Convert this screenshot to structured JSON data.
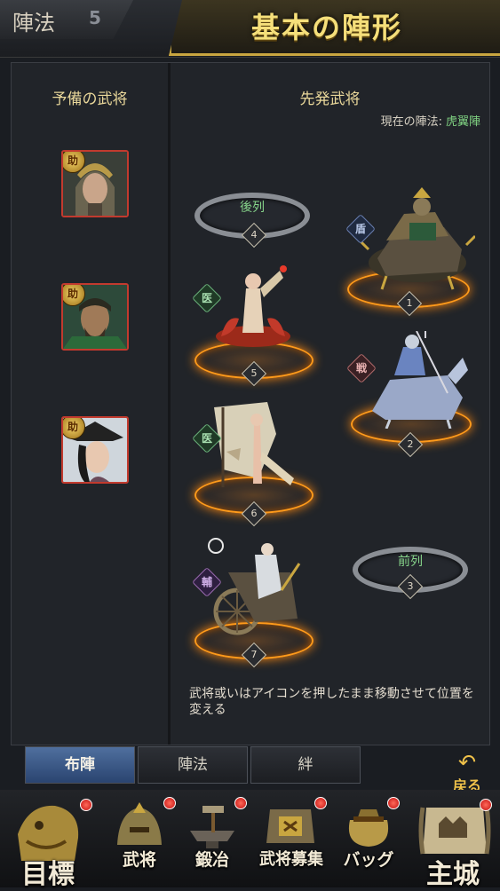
{
  "header": {
    "left_title": "陣法",
    "left_mark": "5",
    "title": "基本の陣形"
  },
  "reserve": {
    "title": "予備の武将",
    "badge": "助",
    "portraits": [
      {
        "name": "reserve-general-1"
      },
      {
        "name": "reserve-general-2"
      },
      {
        "name": "reserve-general-3"
      }
    ]
  },
  "starters": {
    "title": "先発武将",
    "current_label": "現在の陣法:",
    "current_value": "虎翼陣",
    "back_row_label": "後列",
    "front_row_label": "前列",
    "slots": {
      "s1": "1",
      "s2": "2",
      "s3": "3",
      "s4": "4",
      "s5": "5",
      "s6": "6",
      "s7": "7"
    },
    "roles": {
      "shield": "盾",
      "heal5": "医",
      "battle": "戦",
      "heal6": "医",
      "support": "輔"
    },
    "hint": "武将或いはアイコンを押したまま移動させて位置を変える"
  },
  "tabs": [
    {
      "label": "布陣"
    },
    {
      "label": "陣法"
    },
    {
      "label": "絆"
    }
  ],
  "back": {
    "label": "戻る"
  },
  "nav": [
    {
      "label": "目標"
    },
    {
      "label": "武将"
    },
    {
      "label": "鍛冶"
    },
    {
      "label": "武将募集"
    },
    {
      "label": "バッグ"
    },
    {
      "label": "主城"
    }
  ],
  "colors": {
    "accent_gold": "#f5df7a",
    "green_text": "#7fd081",
    "ring_orange": "#ff9a1a",
    "tab_active": "#3a5886"
  }
}
